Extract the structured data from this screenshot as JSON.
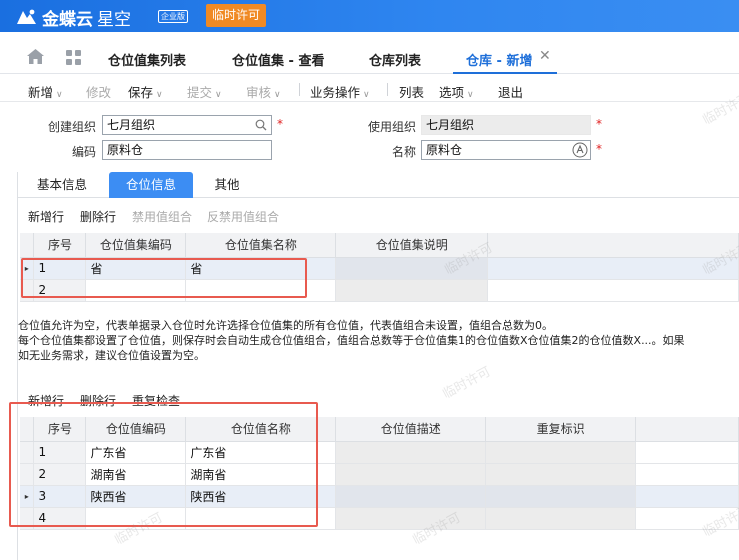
{
  "app": {
    "logo_text": "金蝶云",
    "logo_sub": "星空",
    "edition": "企业版",
    "temp_license": "临时许可"
  },
  "tabs": [
    {
      "label": "仓位值集列表"
    },
    {
      "label": "仓位值集 - 查看"
    },
    {
      "label": "仓库列表"
    },
    {
      "label": "仓库 - 新增"
    }
  ],
  "toolbar": {
    "new": "新增",
    "modify": "修改",
    "save": "保存",
    "submit": "提交",
    "audit": "审核",
    "business_ops": "业务操作",
    "list": "列表",
    "options": "选项",
    "exit": "退出"
  },
  "form": {
    "create_org_label": "创建组织",
    "create_org_value": "七月组织",
    "use_org_label": "使用组织",
    "use_org_value": "七月组织",
    "code_label": "编码",
    "code_value": "原料仓",
    "name_label": "名称",
    "name_value": "原料仓",
    "required_mark": "*"
  },
  "subtabs": [
    {
      "label": "基本信息"
    },
    {
      "label": "仓位信息"
    },
    {
      "label": "其他"
    }
  ],
  "grid1_actions": {
    "add_row": "新增行",
    "delete_row": "删除行",
    "disable_combo": "禁用值组合",
    "undisable_combo": "反禁用值组合"
  },
  "grid1": {
    "headers": [
      "序号",
      "仓位值集编码",
      "仓位值集名称",
      "仓位值集说明"
    ],
    "rows": [
      {
        "seq": "1",
        "code": "省",
        "name": "省",
        "desc": ""
      },
      {
        "seq": "2",
        "code": "",
        "name": "",
        "desc": ""
      }
    ],
    "row_marker": "▸"
  },
  "notes": {
    "line1": "仓位值允许为空，代表单据录入仓位时允许选择仓位值集的所有仓位值，代表值组合未设置，值组合总数为0。",
    "line2": "每个仓位值集都设置了仓位值，则保存时会自动生成仓位值组合，值组合总数等于仓位值集1的仓位值数X仓位值集2的仓位值数X...。如果",
    "line3": "如无业务需求，建议仓位值设置为空。"
  },
  "grid2_actions": {
    "add_row": "新增行",
    "delete_row": "删除行",
    "recheck": "重复检查"
  },
  "grid2": {
    "headers": [
      "序号",
      "仓位值编码",
      "仓位值名称",
      "仓位值描述",
      "重复标识"
    ],
    "rows": [
      {
        "seq": "1",
        "code": "广东省",
        "name": "广东省"
      },
      {
        "seq": "2",
        "code": "湖南省",
        "name": "湖南省"
      },
      {
        "seq": "3",
        "code": "陕西省",
        "name": "陕西省"
      },
      {
        "seq": "4",
        "code": "",
        "name": ""
      }
    ],
    "row_marker": "▸"
  },
  "watermark_text": "临时许可",
  "colors": {
    "brand": "#2a80ec",
    "accent": "#1e6fd9",
    "license": "#f08a24",
    "highlight_box": "#e85a4f"
  }
}
